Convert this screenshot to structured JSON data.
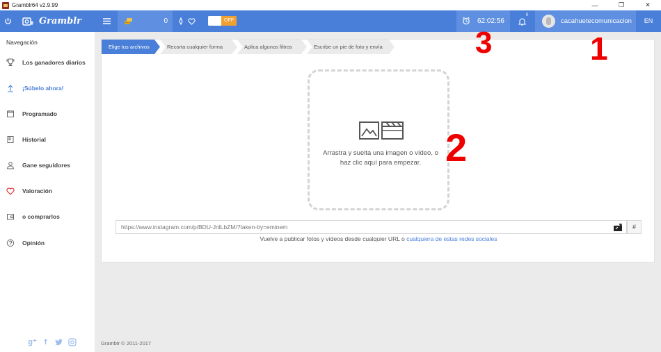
{
  "window": {
    "title": "Gramblr64 v2.9.99",
    "minimize": "—",
    "maximize": "❐",
    "close": "✕"
  },
  "navbar": {
    "brand": "Gramblr",
    "coins": "0",
    "toggle_label": "OFF",
    "timer": "62:02:56",
    "notifications": "0",
    "username": "cacahuetecomunicacion",
    "language": "EN",
    "colors": {
      "bar": "#4a7fd9",
      "highlight": "#5e8fe0",
      "toggle_off": "#f0a030"
    }
  },
  "sidebar": {
    "heading": "Navegación",
    "items": [
      {
        "label": "Los ganadores diarios",
        "icon": "trophy-icon"
      },
      {
        "label": "¡Súbelo ahora!",
        "icon": "upload-icon",
        "active": true
      },
      {
        "label": "Programado",
        "icon": "calendar-icon"
      },
      {
        "label": "Historial",
        "icon": "history-icon"
      },
      {
        "label": "Gane seguidores",
        "icon": "user-icon"
      },
      {
        "label": "Valoración",
        "icon": "heart-icon"
      },
      {
        "label": "o comprarlos",
        "icon": "wallet-icon"
      },
      {
        "label": "Opinión",
        "icon": "help-icon"
      }
    ],
    "social": [
      "google-plus-icon",
      "facebook-icon",
      "twitter-icon",
      "instagram-icon"
    ]
  },
  "main": {
    "steps": [
      "Elige tus archivos",
      "Recorta cualquier forma",
      "Aplica algunos filtros",
      "Escribe un pie de foto y envía"
    ],
    "dropzone_text": "Arrastra y suelta una imagen o vídeo, o haz clic aquí para empezar.",
    "url_placeholder": "https://www.instagram.com/p/BDU-JnlLbZM/?taken-by=eminem",
    "hash_button": "#",
    "republish_text": "Vuelve a publicar fotos y vídeos desde cualquier URL o ",
    "republish_link": "cualquiera de estas redes sociales"
  },
  "footer": {
    "copyright": "Gramblr © 2011-2017"
  },
  "annotations": [
    "1",
    "2",
    "3"
  ]
}
